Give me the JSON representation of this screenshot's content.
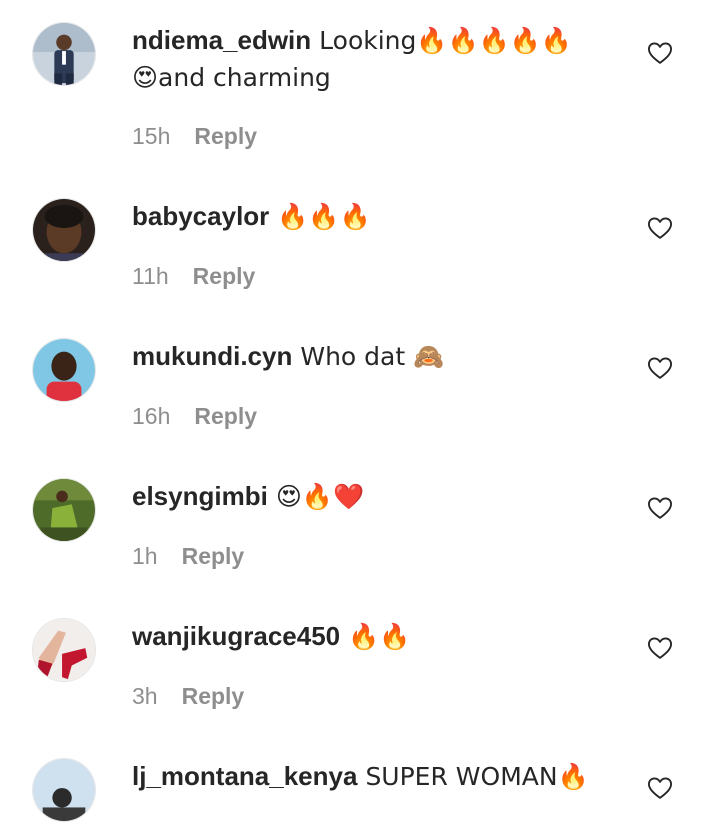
{
  "comments": [
    {
      "username": "ndiema_edwin",
      "text": "Looking🔥🔥🔥🔥🔥\n😍and charming",
      "time": "15h",
      "reply_label": "Reply",
      "avatar_icon": "profile-photo-man-suit",
      "like_icon": "heart-outline-icon"
    },
    {
      "username": "babycaylor",
      "text": "🔥🔥🔥",
      "time": "11h",
      "reply_label": "Reply",
      "avatar_icon": "profile-photo-woman",
      "like_icon": "heart-outline-icon"
    },
    {
      "username": "mukundi.cyn",
      "text": "Who dat 🙈",
      "time": "16h",
      "reply_label": "Reply",
      "avatar_icon": "profile-photo-child",
      "like_icon": "heart-outline-icon"
    },
    {
      "username": "elsyngimbi",
      "text": "😍🔥❤️",
      "time": "1h",
      "reply_label": "Reply",
      "avatar_icon": "profile-photo-outdoor",
      "like_icon": "heart-outline-icon"
    },
    {
      "username": "wanjikugrace450",
      "text": "🔥🔥",
      "time": "3h",
      "reply_label": "Reply",
      "avatar_icon": "profile-photo-red-heels",
      "like_icon": "heart-outline-icon"
    },
    {
      "username": "lj_montana_kenya",
      "text": "SUPER WOMAN🔥",
      "time": "",
      "reply_label": "",
      "avatar_icon": "profile-photo-sky",
      "like_icon": "heart-outline-icon"
    }
  ],
  "colors": {
    "username": "#262626",
    "meta": "#8e8e8e",
    "background": "#ffffff"
  }
}
